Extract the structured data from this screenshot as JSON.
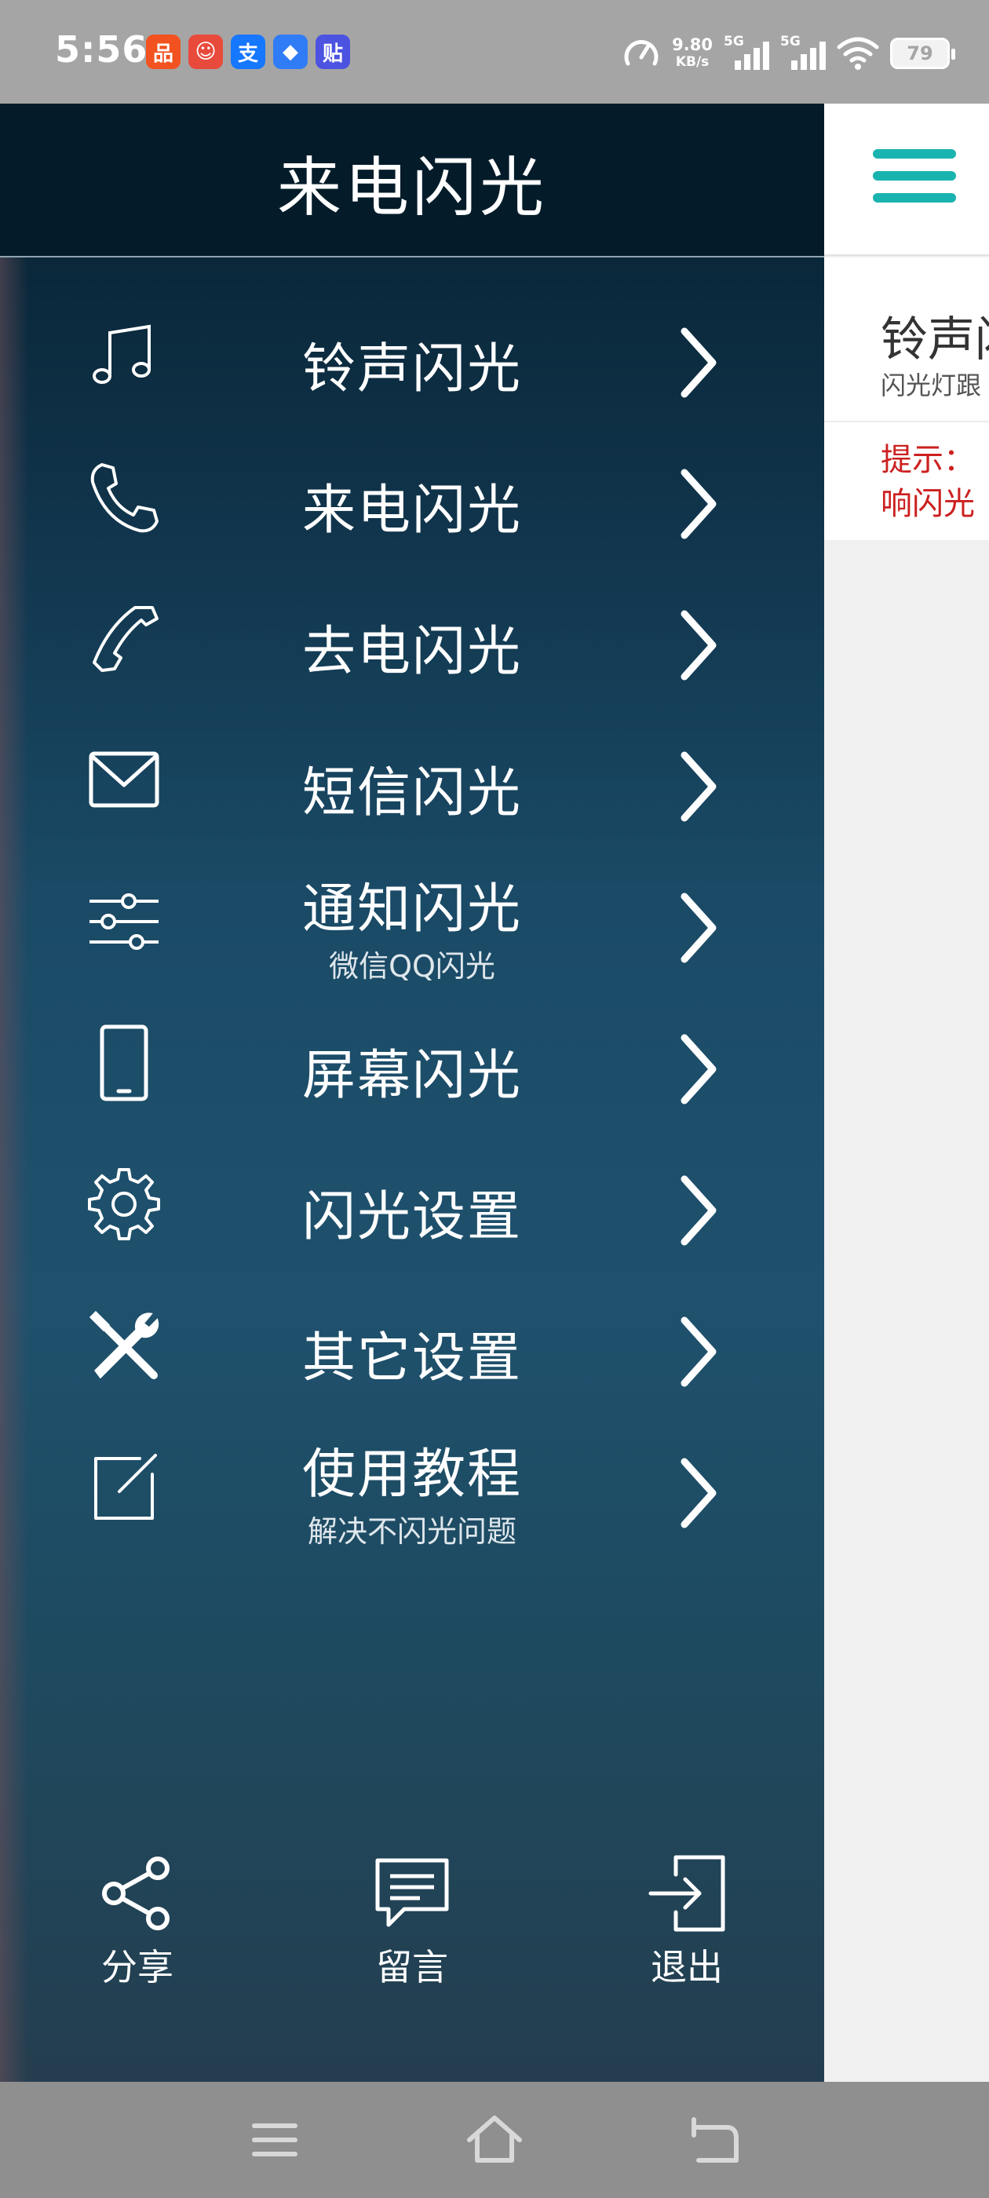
{
  "status_bar": {
    "time": "5:56",
    "app_icons": [
      {
        "name": "kuaishou-icon",
        "glyph": "品",
        "color": "#f2521f"
      },
      {
        "name": "taobao-icon",
        "glyph": "☺",
        "color": "#e84a3c"
      },
      {
        "name": "alipay-icon",
        "glyph": "支",
        "color": "#1677ff"
      },
      {
        "name": "browser-icon",
        "glyph": "◆",
        "color": "#2f7cf6"
      },
      {
        "name": "tieba-icon",
        "glyph": "贴",
        "color": "#4b53e0"
      }
    ],
    "net_speed": "9.80",
    "net_speed_unit": "KB/s",
    "signal1_label": "5G",
    "signal2_label": "5G",
    "battery": "79"
  },
  "drawer": {
    "title": "来电闪光",
    "items": [
      {
        "label": "铃声闪光",
        "sub": "",
        "icon": "music-note-icon"
      },
      {
        "label": "来电闪光",
        "sub": "",
        "icon": "phone-icon"
      },
      {
        "label": "去电闪光",
        "sub": "",
        "icon": "handset-icon"
      },
      {
        "label": "短信闪光",
        "sub": "",
        "icon": "envelope-icon"
      },
      {
        "label": "通知闪光",
        "sub": "微信QQ闪光",
        "icon": "sliders-icon"
      },
      {
        "label": "屏幕闪光",
        "sub": "",
        "icon": "smartphone-icon"
      },
      {
        "label": "闪光设置",
        "sub": "",
        "icon": "gear-icon"
      },
      {
        "label": "其它设置",
        "sub": "",
        "icon": "tools-icon"
      },
      {
        "label": "使用教程",
        "sub": "解决不闪光问题",
        "icon": "edit-icon"
      }
    ],
    "actions": [
      {
        "label": "分享",
        "icon": "share-icon"
      },
      {
        "label": "留言",
        "icon": "message-icon"
      },
      {
        "label": "退出",
        "icon": "exit-icon"
      }
    ]
  },
  "content": {
    "card_title": "铃声闪",
    "card_subtitle": "闪光灯跟",
    "hint_line1": "提示：",
    "hint_line2": "响闪光"
  },
  "colors": {
    "accent": "#19b3b0",
    "hint": "#cc2020",
    "drawer_top": "#041c2a"
  }
}
